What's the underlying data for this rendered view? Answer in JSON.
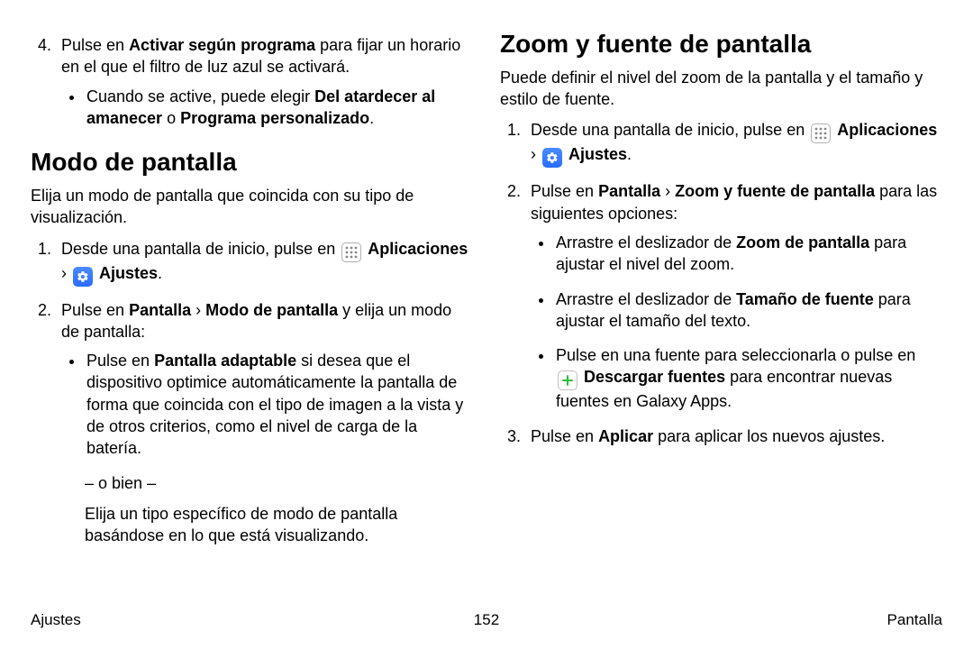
{
  "left": {
    "top_list_start": 4,
    "top_items": [
      {
        "pre": "Pulse en ",
        "bold1": "Activar según programa",
        "post": " para fijar un horario en el que el filtro de luz azul se activará.",
        "sub": {
          "pre": "Cuando se active, puede elegir ",
          "bold1": "Del atardecer al amanecer",
          "mid": " o ",
          "bold2": "Programa personalizado",
          "post": "."
        }
      }
    ],
    "heading": "Modo de pantalla",
    "lead": "Elija un modo de pantalla que coincida con su tipo de visualización.",
    "steps": [
      {
        "pre": "Desde una pantalla de inicio, pulse en ",
        "apps": "Aplicaciones",
        "chevron": " › ",
        "settings": "Ajustes",
        "post": "."
      },
      {
        "pre": "Pulse en ",
        "bold1": "Pantalla",
        "chevron": " › ",
        "bold2": "Modo de pantalla",
        "post": " y elija un modo de pantalla:",
        "bullets": [
          {
            "pre": "Pulse en ",
            "bold1": "Pantalla adaptable",
            "post": " si desea que el dispositivo optimice automáticamente la pantalla de forma que coincida con el tipo de imagen a la vista y de otros criterios, como el nivel de carga de la batería."
          }
        ],
        "obien": "– o bien –",
        "after": "Elija un tipo específico de modo de pantalla basándose en lo que está visualizando."
      }
    ]
  },
  "right": {
    "heading": "Zoom y fuente de pantalla",
    "lead": "Puede definir el nivel del zoom de la pantalla y el tamaño y estilo de fuente.",
    "steps": [
      {
        "pre": "Desde una pantalla de inicio, pulse en ",
        "apps": "Aplicaciones",
        "chevron": " › ",
        "settings": "Ajustes",
        "post": "."
      },
      {
        "pre": "Pulse en ",
        "bold1": "Pantalla",
        "chevron": " › ",
        "bold2": "Zoom y fuente de pantalla",
        "post": " para las siguientes opciones:",
        "bullets": [
          {
            "pre": "Arrastre el deslizador de ",
            "bold1": "Zoom de pantalla",
            "post": " para ajustar el nivel del zoom."
          },
          {
            "pre": "Arrastre el deslizador de ",
            "bold1": "Tamaño de fuente",
            "post": " para ajustar el tamaño del texto."
          },
          {
            "pre": "Pulse en una fuente para seleccionarla o pulse en ",
            "bold1": "Descargar fuentes",
            "post": " para encontrar nuevas fuentes en Galaxy Apps.",
            "download_icon": true
          }
        ]
      },
      {
        "pre": "Pulse en ",
        "bold1": "Aplicar",
        "post": " para aplicar los nuevos ajustes."
      }
    ]
  },
  "footer": {
    "left": "Ajustes",
    "center": "152",
    "right": "Pantalla"
  }
}
